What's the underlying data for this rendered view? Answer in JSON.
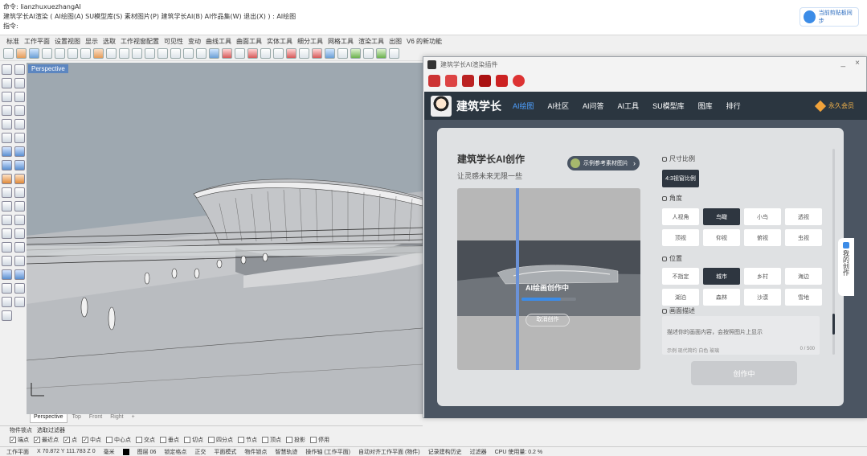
{
  "command": {
    "lines": [
      "命令: lianzhuxuezhangAI",
      "建筑学长AI渲染 ( AI绘图(A)  SU模型库(S)  素材图片(P)  建筑学长AI(B)  AI作品集(W)  退出(X) ) : AI绘图",
      "指令:"
    ]
  },
  "sync": {
    "label": "当前剪贴板同步"
  },
  "menubar": [
    "标准",
    "工作平面",
    "设置视图",
    "显示",
    "选取",
    "工作视窗配置",
    "可见性",
    "变动",
    "曲线工具",
    "曲面工具",
    "实体工具",
    "细分工具",
    "网格工具",
    "渲染工具",
    "出图",
    "V6 的新功能"
  ],
  "viewport": {
    "label": "Perspective"
  },
  "viewtabs": [
    "Perspective",
    "Top",
    "Front",
    "Right",
    "+"
  ],
  "paneltabs": [
    "物件锁点",
    "选取过滤器"
  ],
  "osnap": [
    {
      "label": "端点",
      "checked": true
    },
    {
      "label": "最近点",
      "checked": true
    },
    {
      "label": "点",
      "checked": true
    },
    {
      "label": "中点",
      "checked": true
    },
    {
      "label": "中心点",
      "checked": false
    },
    {
      "label": "交点",
      "checked": false
    },
    {
      "label": "垂点",
      "checked": false
    },
    {
      "label": "切点",
      "checked": false
    },
    {
      "label": "四分点",
      "checked": false
    },
    {
      "label": "节点",
      "checked": false
    },
    {
      "label": "顶点",
      "checked": false
    },
    {
      "label": "投影",
      "checked": false
    },
    {
      "label": "停用",
      "checked": false
    }
  ],
  "status": {
    "workplane": "工作平面",
    "coords": "X 70.872 Y 111.783 Z 0",
    "units": "毫米",
    "layer": "图层 06",
    "items": [
      "锁定格点",
      "正交",
      "平面模式",
      "物件锁点",
      "智慧轨迹",
      "操作轴 (工作平面)",
      "自动对齐工作平面 (物件)",
      "记录建构历史",
      "过滤器",
      "CPU 使用量: 0.2 %"
    ]
  },
  "plugin": {
    "window_title": "建筑学长AI渲染插件",
    "brand": "建筑学长",
    "nav": [
      "AI绘图",
      "AI社区",
      "AI问答",
      "AI工具",
      "SU模型库",
      "图库",
      "排行"
    ],
    "active_nav": "AI绘图",
    "vip": "永久会员",
    "card": {
      "title": "建筑学长AI创作",
      "subtitle": "让灵感未来无限一些",
      "sample_label": "示例参考素材图片",
      "generating_label": "AI绘画创作中",
      "progress": 0.72,
      "cancel_label": "取消创作",
      "size_label": "尺寸比例",
      "size_button": "4:3视窗比例",
      "angle_label": "角度",
      "angle_options": [
        "人视角",
        "鸟瞰",
        "小鸟",
        "透视",
        "顶视",
        "仰视",
        "俯视",
        "虫视"
      ],
      "angle_selected": 1,
      "location_label": "位置",
      "location_options": [
        "不指定",
        "城市",
        "乡村",
        "海边",
        "湖泊",
        "森林",
        "沙漠",
        "雪地"
      ],
      "location_selected": 1,
      "desc_label": "画面描述",
      "desc_placeholder": "描述你的画面内容，会按照图片上显示",
      "desc_tags": "示例  现代简约  白色  玻璃",
      "desc_count": "0 / 500",
      "create_label": "创作中"
    },
    "side_tab": "我的创作"
  },
  "colors": {
    "nav_bg": "#2b3640",
    "accent": "#3c8ce7",
    "viewport_bg": "#9ea8b0",
    "selected_option": "#2e3640"
  }
}
